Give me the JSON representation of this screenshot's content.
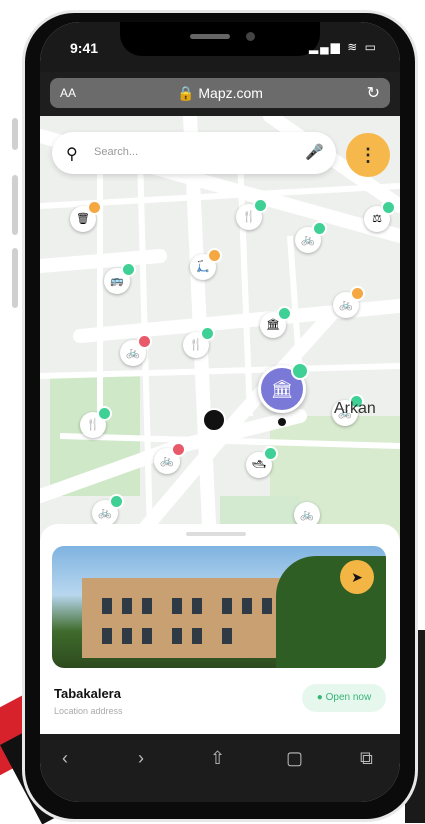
{
  "status_bar": {
    "time": "9:41",
    "signal": "▂▄▆",
    "wifi": "≋",
    "battery": "▭"
  },
  "browser": {
    "text_size": "AA",
    "url": "Mapz.com",
    "lock_icon": "lock-icon",
    "reload_icon": "reload-icon"
  },
  "search": {
    "placeholder": "Search...",
    "mic_icon": "mic-icon",
    "menu_icon": "more-vertical-icon"
  },
  "map": {
    "label": "Arkan",
    "pins": [
      {
        "icon": "bin-icon",
        "status": "orange"
      },
      {
        "icon": "restaurant-icon",
        "status": "green"
      },
      {
        "icon": "monument-icon",
        "status": "green"
      },
      {
        "icon": "bike-icon",
        "status": "green"
      },
      {
        "icon": "bus-icon",
        "status": "green"
      },
      {
        "icon": "scooter-icon",
        "status": "orange"
      },
      {
        "icon": "bike-icon",
        "status": "orange"
      },
      {
        "icon": "museum-icon",
        "status": "green"
      },
      {
        "icon": "bike-icon",
        "status": "red"
      },
      {
        "icon": "restaurant-icon",
        "status": "green"
      },
      {
        "icon": "restaurant-icon",
        "status": "green"
      },
      {
        "icon": "bike-icon",
        "status": "red"
      },
      {
        "icon": "boat-icon",
        "status": "green"
      },
      {
        "icon": "bike-icon",
        "status": "green"
      },
      {
        "icon": "bike-icon",
        "status": "green"
      }
    ],
    "selected_pin_icon": "tower-icon"
  },
  "place_card": {
    "name": "Tabakalera",
    "address": "Location address",
    "status": "Open now",
    "navigate_icon": "navigation-arrow-icon"
  },
  "colors": {
    "accent": "#f6b84a",
    "purple": "#7b79d8",
    "green": "#3fd095",
    "orange": "#f5a742",
    "red": "#e85a6a"
  },
  "toolbar": {
    "back": "‹",
    "forward": "›",
    "share": "⇧",
    "bookmarks": "▢",
    "tabs": "⧉"
  }
}
